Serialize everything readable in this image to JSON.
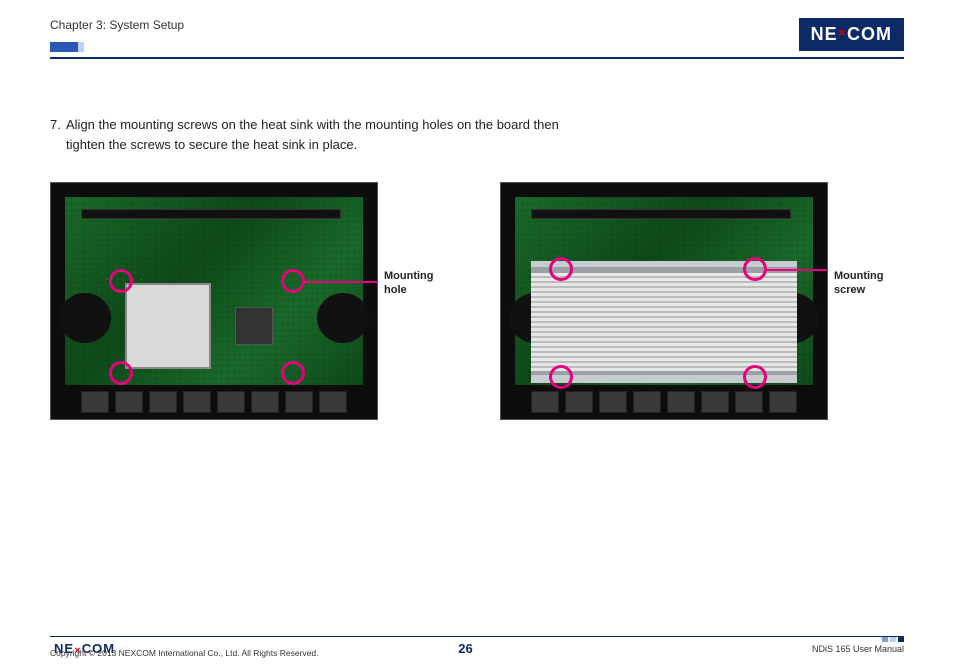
{
  "header": {
    "chapter": "Chapter 3: System Setup",
    "brand_left": "NE",
    "brand_x": "✕",
    "brand_right": "COM"
  },
  "step": {
    "number": "7.",
    "text": "Align the mounting screws on the heat sink with the mounting holes on the board then tighten the screws to secure the heat sink in place."
  },
  "figure1": {
    "callout_line1": "Mounting",
    "callout_line2": "hole"
  },
  "figure2": {
    "callout_line1": "Mounting",
    "callout_line2": "screw"
  },
  "footer": {
    "logo_left": "NE",
    "logo_x": "✕",
    "logo_right": "COM",
    "copyright": "Copyright © 2013 NEXCOM International Co., Ltd. All Rights Reserved.",
    "page": "26",
    "doc": "NDiS 165 User Manual"
  }
}
